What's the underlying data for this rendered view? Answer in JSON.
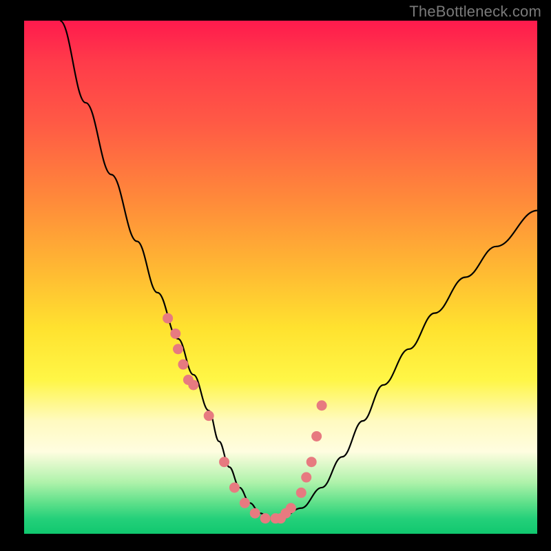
{
  "watermark": "TheBottleneck.com",
  "chart_data": {
    "type": "line",
    "title": "",
    "xlabel": "",
    "ylabel": "",
    "xlim": [
      0,
      100
    ],
    "ylim": [
      0,
      100
    ],
    "series": [
      {
        "name": "bottleneck-curve",
        "x": [
          7,
          12,
          17,
          22,
          26,
          30,
          33,
          36,
          38,
          40,
          42,
          44,
          46,
          48,
          50,
          54,
          58,
          62,
          66,
          70,
          75,
          80,
          86,
          92,
          100
        ],
        "y": [
          100,
          84,
          70,
          57,
          47,
          38,
          31,
          24,
          18,
          13,
          9,
          6,
          4,
          3,
          3,
          5,
          9,
          15,
          22,
          29,
          36,
          43,
          50,
          56,
          63
        ]
      }
    ],
    "markers": {
      "name": "highlighted-points",
      "x": [
        28,
        29.5,
        30,
        31,
        32,
        33,
        36,
        39,
        41,
        43,
        45,
        47,
        49,
        50,
        51,
        52,
        54,
        55,
        56,
        57,
        58
      ],
      "y": [
        42,
        39,
        36,
        33,
        30,
        29,
        23,
        14,
        9,
        6,
        4,
        3,
        3,
        3,
        4,
        5,
        8,
        11,
        14,
        19,
        25
      ]
    },
    "gradient_stops": [
      {
        "pos": 0,
        "color": "#ff1a4d"
      },
      {
        "pos": 35,
        "color": "#ff8a3a"
      },
      {
        "pos": 60,
        "color": "#ffe22f"
      },
      {
        "pos": 84,
        "color": "#fffde0"
      },
      {
        "pos": 100,
        "color": "#10c86f"
      }
    ]
  }
}
